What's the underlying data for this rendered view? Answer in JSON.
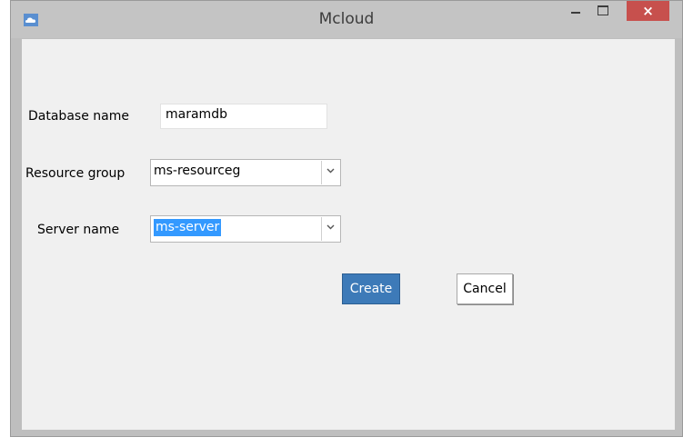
{
  "window": {
    "title": "Mcloud",
    "controls": {
      "minimize": "minimize",
      "maximize": "maximize",
      "close": "×"
    }
  },
  "form": {
    "database_name": {
      "label": "Database name",
      "value": "maramdb"
    },
    "resource_group": {
      "label": "Resource group",
      "value": "ms-resourceg"
    },
    "server_name": {
      "label": "Server name",
      "value": "ms-server",
      "selected": true
    }
  },
  "actions": {
    "create_label": "Create",
    "cancel_label": "Cancel"
  },
  "colors": {
    "primary_button": "#3d7ab8",
    "close_button": "#c7504d",
    "selection": "#3399ff",
    "title_bar": "#c4c4c4",
    "content_bg": "#f0f0f0"
  },
  "icons": [
    "cloud-app-icon",
    "minimize-icon",
    "maximize-icon",
    "close-icon",
    "chevron-down-icon"
  ]
}
